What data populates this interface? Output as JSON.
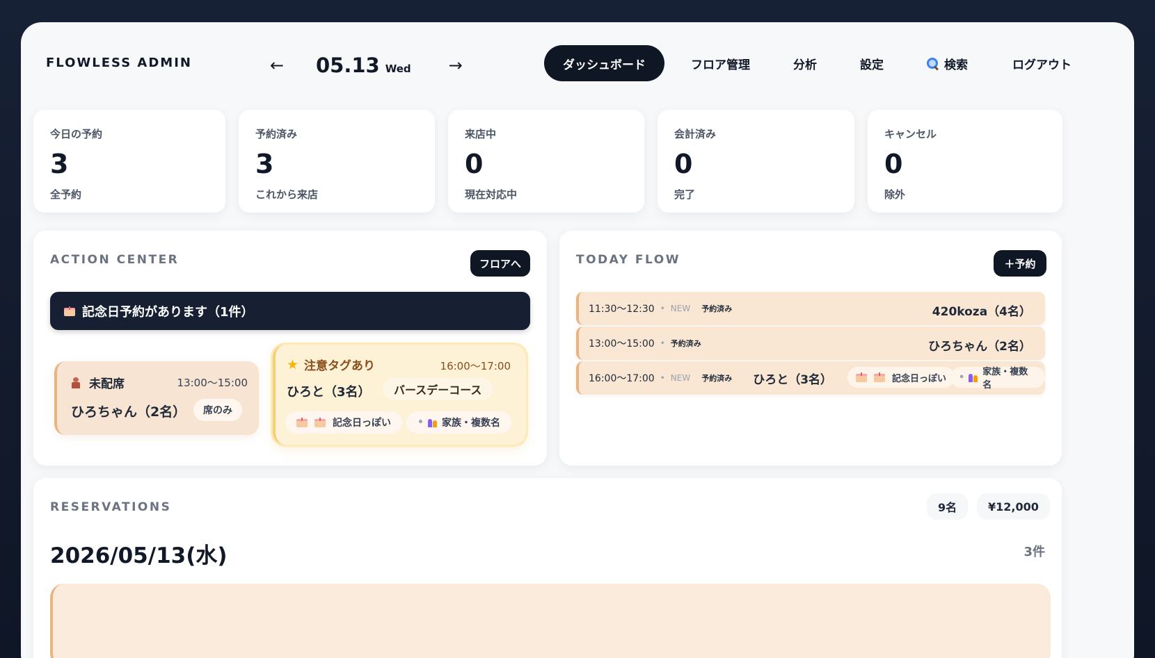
{
  "header": {
    "brand": "FLOWLESS ADMIN",
    "prev_arrow": "←",
    "next_arrow": "→",
    "date": "05.13",
    "weekday": "Wed",
    "nav": [
      "ダッシュボード",
      "フロア管理",
      "分析",
      "設定",
      "検索",
      "ログアウト"
    ]
  },
  "stats": [
    {
      "label": "今日の予約",
      "value": "3",
      "sub": "全予約"
    },
    {
      "label": "予約済み",
      "value": "3",
      "sub": "これから来店"
    },
    {
      "label": "来店中",
      "value": "0",
      "sub": "現在対応中"
    },
    {
      "label": "会計済み",
      "value": "0",
      "sub": "完了"
    },
    {
      "label": "キャンセル",
      "value": "0",
      "sub": "除外"
    }
  ],
  "action_center": {
    "title": "ACTION CENTER",
    "button": "フロアへ",
    "alert": "記念日予約があります（1件）",
    "unseated": {
      "title": "未配席",
      "time": "13:00〜15:00",
      "name": "ひろちゃん（2名）",
      "chip": "席のみ"
    },
    "caution": {
      "title": "注意タグあり",
      "time": "16:00〜17:00",
      "name": "ひろと（3名）",
      "course": "バースデーコース",
      "tag1": "記念日っぽい",
      "tag2": "家族・複数名"
    }
  },
  "today_flow": {
    "title": "TODAY FLOW",
    "button": "＋予約",
    "rows": [
      {
        "time": "11:30〜12:30",
        "new": "NEW",
        "status": "予約済み",
        "name": "420koza（4名）"
      },
      {
        "time": "13:00〜15:00",
        "status": "予約済み",
        "name": "ひろちゃん（2名）"
      },
      {
        "time": "16:00〜17:00",
        "new": "NEW",
        "status": "予約済み",
        "name": "ひろと（3名）",
        "tag1": "記念日っぽい",
        "tag2": "家族・複数名"
      }
    ]
  },
  "reservations": {
    "title": "RESERVATIONS",
    "people": "9名",
    "amount": "¥12,000",
    "date": "2026/05/13(水)",
    "count": "3件"
  }
}
